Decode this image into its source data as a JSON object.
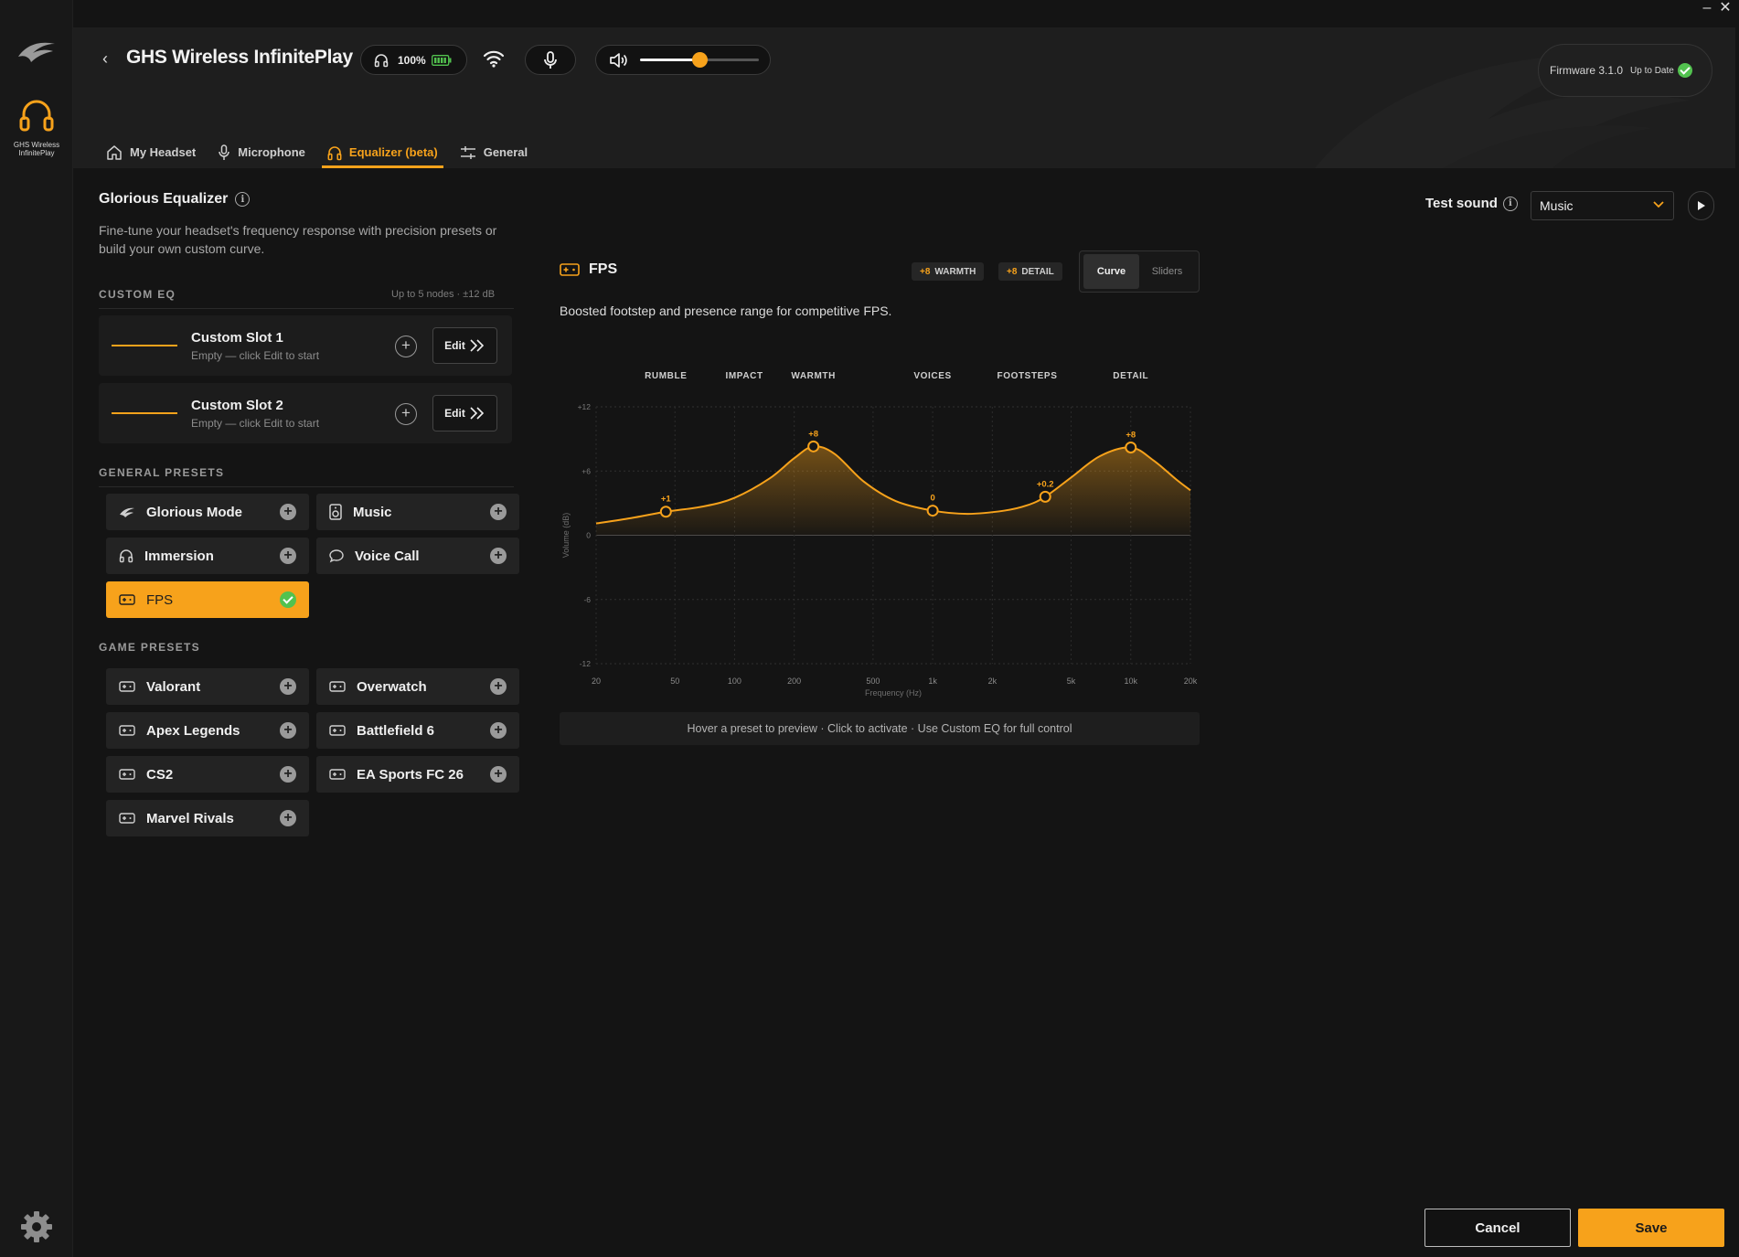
{
  "window": {
    "minimize_label": "–",
    "close_label": "✕"
  },
  "rail": {
    "device_label": "GHS Wireless InfinitePlay"
  },
  "header": {
    "back_label": "‹",
    "device_title": "GHS Wireless InfinitePlay",
    "battery_percent": "100%",
    "volume_level": 0.5,
    "firmware_label": "Firmware 3.1.0",
    "firmware_status": "Up to Date"
  },
  "tabs": [
    {
      "label": "My Headset",
      "icon": "home-icon"
    },
    {
      "label": "Microphone",
      "icon": "mic-icon"
    },
    {
      "label": "Equalizer (beta)",
      "icon": "headphones-icon",
      "active": true
    },
    {
      "label": "General",
      "icon": "sliders-icon"
    }
  ],
  "equalizer": {
    "title": "Glorious Equalizer",
    "info_glyph": "i",
    "description": "Fine-tune your headset's frequency response with precision presets or build your own custom curve."
  },
  "custom_eq": {
    "heading": "CUSTOM EQ",
    "limit": "Up to 5 nodes · ±12 dB",
    "slots": [
      {
        "name": "Custom Slot 1",
        "sub": "Empty — click Edit to start",
        "edit_label": "Edit"
      },
      {
        "name": "Custom Slot 2",
        "sub": "Empty — click Edit to start",
        "edit_label": "Edit"
      }
    ]
  },
  "general_presets": {
    "heading": "GENERAL PRESETS",
    "items": [
      {
        "label": "Glorious Mode",
        "icon": "glorious-bird-icon"
      },
      {
        "label": "Music",
        "icon": "speaker-icon"
      },
      {
        "label": "Immersion",
        "icon": "headphones-icon"
      },
      {
        "label": "Voice Call",
        "icon": "chat-bubble-icon"
      },
      {
        "label": "FPS",
        "icon": "gamepad-icon",
        "active": true
      }
    ]
  },
  "game_presets": {
    "heading": "GAME PRESETS",
    "items": [
      {
        "label": "Valorant"
      },
      {
        "label": "Overwatch"
      },
      {
        "label": "Apex Legends"
      },
      {
        "label": "Battlefield 6"
      },
      {
        "label": "CS2"
      },
      {
        "label": "EA Sports FC 26"
      },
      {
        "label": "Marvel Rivals"
      }
    ]
  },
  "selected_preset": {
    "name": "FPS",
    "tags": [
      {
        "value": "+8",
        "label": "WARMTH"
      },
      {
        "value": "+8",
        "label": "DETAIL"
      }
    ],
    "view_options": [
      "Curve",
      "Sliders"
    ],
    "view_active": "Curve",
    "description": "Boosted footstep and presence range for competitive FPS."
  },
  "test_sound": {
    "label": "Test sound",
    "info_glyph": "i",
    "selected": "Music"
  },
  "hint": "Hover a preset to preview · Click to activate · Use Custom EQ for full control",
  "footer": {
    "cancel_label": "Cancel",
    "save_label": "Save"
  },
  "colors": {
    "accent": "#f7a21b",
    "success": "#52c24f",
    "background": "#141414"
  },
  "chart_data": {
    "type": "line",
    "xlabel": "Frequency (Hz)",
    "ylabel": "Volume (dB)",
    "x_scale": "log",
    "xlim": [
      20,
      20000
    ],
    "ylim": [
      -12,
      12
    ],
    "x_ticks": [
      {
        "v": 20,
        "label": "20"
      },
      {
        "v": 50,
        "label": "50"
      },
      {
        "v": 100,
        "label": "100"
      },
      {
        "v": 200,
        "label": "200"
      },
      {
        "v": 500,
        "label": "500"
      },
      {
        "v": 1000,
        "label": "1k"
      },
      {
        "v": 2000,
        "label": "2k"
      },
      {
        "v": 5000,
        "label": "5k"
      },
      {
        "v": 10000,
        "label": "10k"
      },
      {
        "v": 20000,
        "label": "20k"
      }
    ],
    "y_ticks": [
      {
        "v": 12,
        "label": "+12"
      },
      {
        "v": 6,
        "label": "+6"
      },
      {
        "v": 0,
        "label": "0"
      },
      {
        "v": -6,
        "label": "-6"
      },
      {
        "v": -12,
        "label": "-12"
      }
    ],
    "bands": [
      {
        "label": "RUMBLE",
        "center": 45
      },
      {
        "label": "IMPACT",
        "center": 112
      },
      {
        "label": "WARMTH",
        "center": 250
      },
      {
        "label": "VOICES",
        "center": 1000
      },
      {
        "label": "FOOTSTEPS",
        "center": 3000
      },
      {
        "label": "DETAIL",
        "center": 10000
      }
    ],
    "grid": true,
    "nodes": [
      {
        "freq": 45,
        "gain": 2.2,
        "label": "+1"
      },
      {
        "freq": 250,
        "gain": 8.3,
        "label": "+8"
      },
      {
        "freq": 1000,
        "gain": 2.3,
        "label": "0"
      },
      {
        "freq": 3700,
        "gain": 3.6,
        "label": "+0.2"
      },
      {
        "freq": 10000,
        "gain": 8.2,
        "label": "+8"
      }
    ],
    "curve": [
      [
        20,
        1.1
      ],
      [
        30,
        1.6
      ],
      [
        45,
        2.2
      ],
      [
        70,
        2.7
      ],
      [
        100,
        3.5
      ],
      [
        150,
        5.3
      ],
      [
        200,
        7.2
      ],
      [
        250,
        8.3
      ],
      [
        320,
        7.6
      ],
      [
        450,
        5.0
      ],
      [
        650,
        3.2
      ],
      [
        1000,
        2.3
      ],
      [
        1500,
        2.0
      ],
      [
        2300,
        2.3
      ],
      [
        3000,
        2.8
      ],
      [
        3700,
        3.6
      ],
      [
        5000,
        5.4
      ],
      [
        7000,
        7.4
      ],
      [
        10000,
        8.2
      ],
      [
        13000,
        7.0
      ],
      [
        17000,
        5.2
      ],
      [
        20000,
        4.2
      ]
    ]
  }
}
